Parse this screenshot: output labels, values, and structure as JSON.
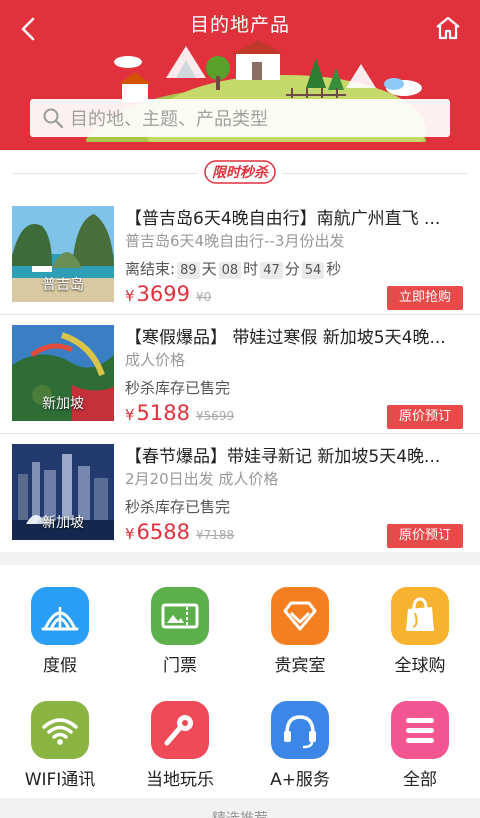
{
  "header": {
    "title": "目的地产品",
    "search_placeholder": "目的地、主题、产品类型",
    "colors": {
      "brand_red": "#e0313d"
    }
  },
  "flash_sale": {
    "badge_text": "限时秒杀",
    "items": [
      {
        "title": "【普吉岛6天4晚自由行】南航广州直飞 ...",
        "subtitle": "普吉岛6天4晚自由行--3月份出发",
        "line3_prefix": "离结束:",
        "countdown": [
          "89",
          "47",
          "54"
        ],
        "countdown_extra": "08",
        "unit_day": "天",
        "unit_hour": "时",
        "unit_min": "分",
        "unit_sec": "秒",
        "currency": "¥",
        "price": "3699",
        "old_price": "¥0",
        "button": "立即抢购",
        "image_caption": "普吉岛"
      },
      {
        "title": "【寒假爆品】 带娃过寒假 新加坡5天4晚...",
        "subtitle": "成人价格",
        "line3": "秒杀库存已售完",
        "currency": "¥",
        "price": "5188",
        "old_price": "¥5699",
        "button": "原价预订",
        "image_caption": "新加坡"
      },
      {
        "title": "【春节爆品】带娃寻新记 新加坡5天4晚...",
        "subtitle": "2月20日出发 成人价格",
        "line3": "秒杀库存已售完",
        "currency": "¥",
        "price": "6588",
        "old_price": "¥7188",
        "button": "原价预订",
        "image_caption": "新加坡"
      }
    ]
  },
  "categories": [
    {
      "label": "度假",
      "icon": "tent-icon",
      "color": "#2a9df4"
    },
    {
      "label": "门票",
      "icon": "ticket-icon",
      "color": "#5bb04b"
    },
    {
      "label": "贵宾室",
      "icon": "diamond-icon",
      "color": "#f37f21"
    },
    {
      "label": "全球购",
      "icon": "shopping-bag-icon",
      "color": "#f7b330"
    },
    {
      "label": "WIFI通讯",
      "icon": "wifi-icon",
      "color": "#8bb542"
    },
    {
      "label": "当地玩乐",
      "icon": "microphone-icon",
      "color": "#ee4a57"
    },
    {
      "label": "A+服务",
      "icon": "headset-icon",
      "color": "#3b86e6"
    },
    {
      "label": "全部",
      "icon": "menu-icon",
      "color": "#f2558f"
    }
  ],
  "footer": {
    "more_label": "精选推荐"
  }
}
